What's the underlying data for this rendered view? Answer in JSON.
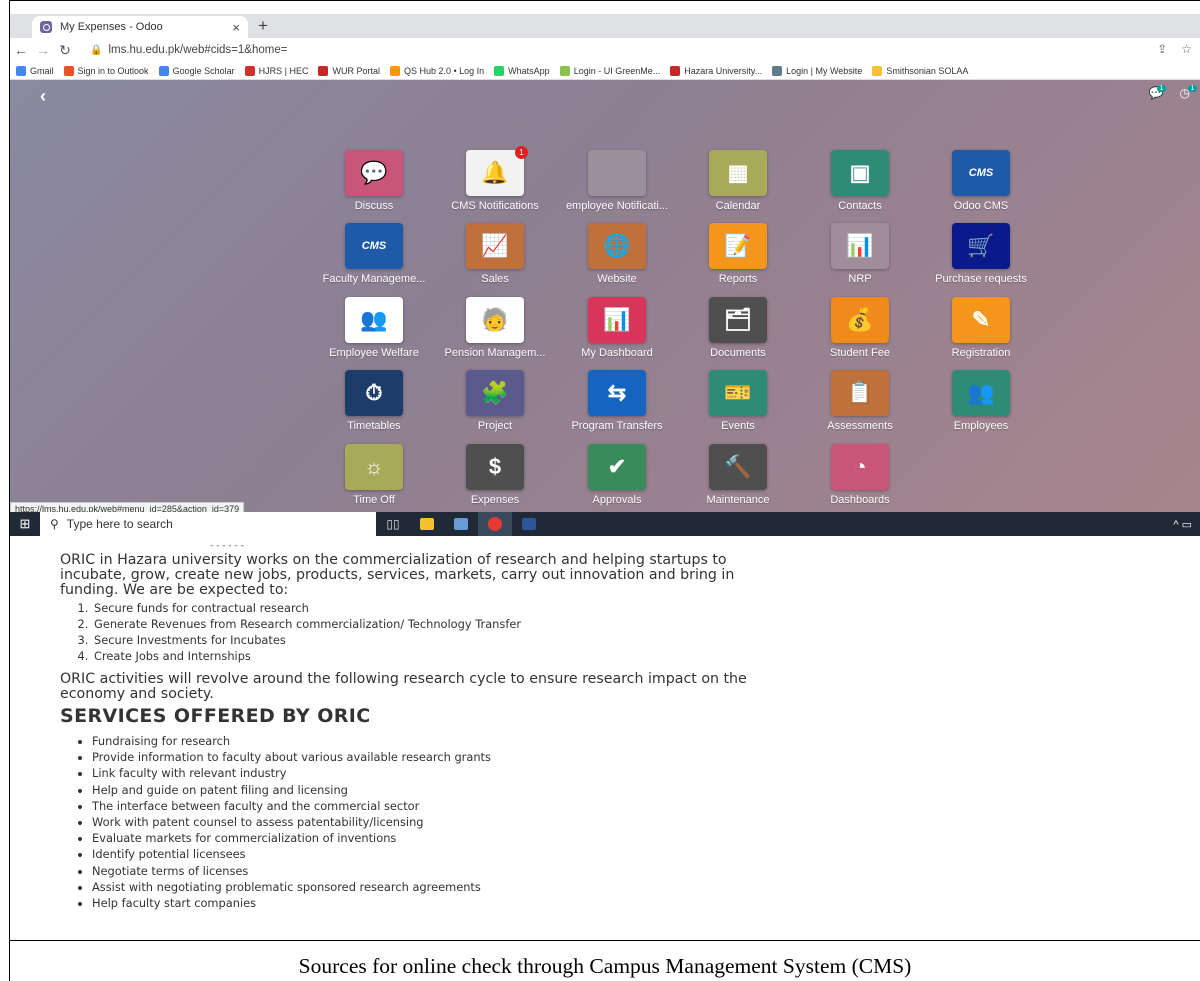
{
  "browser": {
    "tab_title": "My Expenses - Odoo",
    "tab_close": "×",
    "new_tab": "+",
    "url": "lms.hu.edu.pk/web#cids=1&home=",
    "bookmarks": [
      {
        "label": "Gmail",
        "color": "#4285f4"
      },
      {
        "label": "Sign in to Outlook",
        "color": "#f25022"
      },
      {
        "label": "Google Scholar",
        "color": "#4285f4"
      },
      {
        "label": "HJRS | HEC",
        "color": "#d32f2f"
      },
      {
        "label": "WUR Portal",
        "color": "#c62828"
      },
      {
        "label": "QS Hub 2.0 • Log In",
        "color": "#ff9800"
      },
      {
        "label": "WhatsApp",
        "color": "#25d366"
      },
      {
        "label": "Login - UI GreenMe...",
        "color": "#8bc34a"
      },
      {
        "label": "Hazara University...",
        "color": "#c62828"
      },
      {
        "label": "Login | My Website",
        "color": "#607d8b"
      },
      {
        "label": "Smithsonian SOLAA",
        "color": "#fbc02d"
      }
    ],
    "status_url": "https://lms.hu.edu.pk/web#menu_id=285&action_id=379"
  },
  "odoo": {
    "systray_badges": [
      "1",
      "1"
    ],
    "apps": [
      {
        "label": "Discuss",
        "color": "#c9567a",
        "glyph": "💬"
      },
      {
        "label": "CMS Notifications",
        "color": "#f2f2f2",
        "glyph": "🔔",
        "badge": "1",
        "glyph_color": "#e53935"
      },
      {
        "label": "employee Notificati...",
        "color": "#9c8f9c",
        "glyph": ""
      },
      {
        "label": "Calendar",
        "color": "#a9a95a",
        "glyph": "▦"
      },
      {
        "label": "Contacts",
        "color": "#2d8b78",
        "glyph": "▣"
      },
      {
        "label": "Odoo CMS",
        "color": "#1e5aa8",
        "glyph": "CMS"
      },
      {
        "label": "Faculty Manageme...",
        "color": "#1e5aa8",
        "glyph": "CMS"
      },
      {
        "label": "Sales",
        "color": "#c0703a",
        "glyph": "📈"
      },
      {
        "label": "Website",
        "color": "#c0703a",
        "glyph": "🌐"
      },
      {
        "label": "Reports",
        "color": "#f4951c",
        "glyph": "📝"
      },
      {
        "label": "NRP",
        "color": "#9f8d9a",
        "glyph": "📊"
      },
      {
        "label": "Purchase requests",
        "color": "#0a1a8c",
        "glyph": "🛒"
      },
      {
        "label": "Employee Welfare",
        "color": "#ffffff",
        "glyph": "👥",
        "glyph_color": "#2e7d32"
      },
      {
        "label": "Pension Managem...",
        "color": "#ffffff",
        "glyph": "🧓",
        "glyph_color": "#333333"
      },
      {
        "label": "My Dashboard",
        "color": "#d7355a",
        "glyph": "📊"
      },
      {
        "label": "Documents",
        "color": "#4f4f4f",
        "glyph": "🗂"
      },
      {
        "label": "Student Fee",
        "color": "#f08a1c",
        "glyph": "💰"
      },
      {
        "label": "Registration",
        "color": "#f4951c",
        "glyph": "✎"
      },
      {
        "label": "Timetables",
        "color": "#1c3c6a",
        "glyph": "⏱"
      },
      {
        "label": "Project",
        "color": "#5a5a8c",
        "glyph": "🧩"
      },
      {
        "label": "Program Transfers",
        "color": "#1565c0",
        "glyph": "⇆"
      },
      {
        "label": "Events",
        "color": "#2d8b78",
        "glyph": "🎫"
      },
      {
        "label": "Assessments",
        "color": "#c0703a",
        "glyph": "📋"
      },
      {
        "label": "Employees",
        "color": "#2d8b78",
        "glyph": "👥"
      },
      {
        "label": "Time Off",
        "color": "#a9a95a",
        "glyph": "☼"
      },
      {
        "label": "Expenses",
        "color": "#4f4f4f",
        "glyph": "$"
      },
      {
        "label": "Approvals",
        "color": "#3b8a5c",
        "glyph": "✔"
      },
      {
        "label": "Maintenance",
        "color": "#4f4f4f",
        "glyph": "🔨"
      },
      {
        "label": "Dashboards",
        "color": "#c9567a",
        "glyph": "◔"
      }
    ]
  },
  "taskbar": {
    "search_placeholder": "Type here to search"
  },
  "document": {
    "partial_line": "- - - - - -",
    "intro": "ORIC in Hazara university works on the commercialization of research and helping startups to incubate, grow, create new jobs, products, services, markets, carry out innovation and bring in funding. We are be expected to:",
    "goals": [
      "Secure funds for contractual research",
      "Generate Revenues from Research commercialization/ Technology Transfer",
      "Secure Investments for Incubates",
      "Create Jobs and Internships"
    ],
    "cycle_text": "ORIC activities will revolve around the following research cycle to ensure research impact on the economy and society.",
    "services_heading": "SERVICES OFFERED BY ORIC",
    "services": [
      "Fundraising for research",
      "Provide information to faculty about various available research grants",
      "Link faculty with relevant industry",
      "Help and guide on patent filing and licensing",
      "The interface between faculty and the commercial sector",
      "Work with patent counsel to assess patentability/licensing",
      "Evaluate markets for commercialization of inventions",
      "Identify potential licensees",
      "Negotiate terms of licenses",
      "Assist with negotiating problematic sponsored research agreements",
      "Help faculty start companies"
    ],
    "caption": "Sources for online check through Campus Management System (CMS)"
  }
}
